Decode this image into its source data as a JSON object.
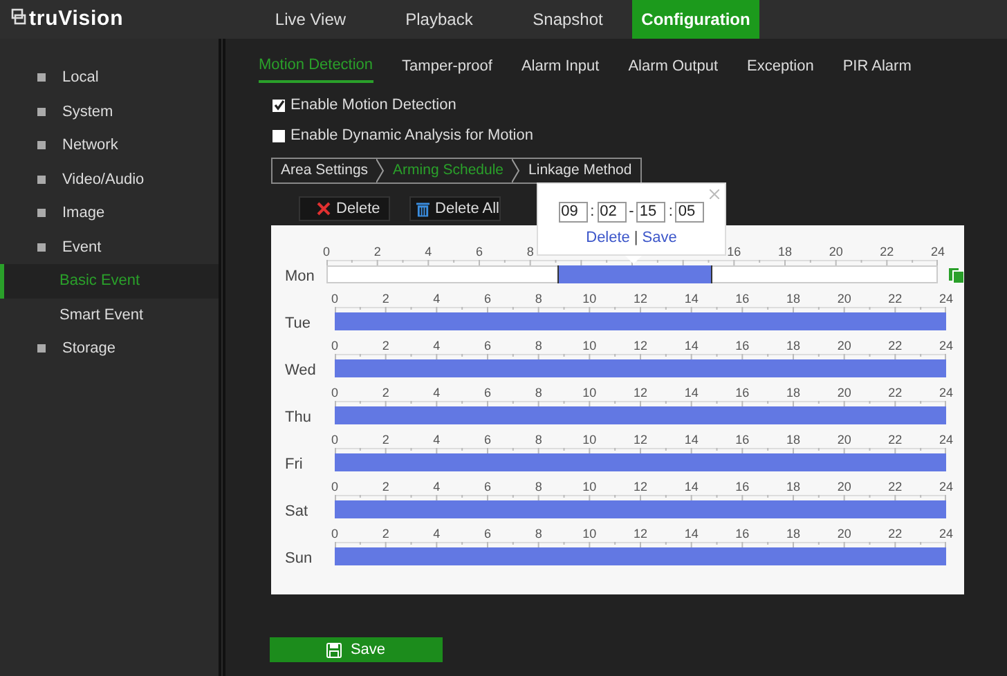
{
  "brand": {
    "name": "truVision"
  },
  "nav": [
    {
      "label": "Live View",
      "selected": false
    },
    {
      "label": "Playback",
      "selected": false
    },
    {
      "label": "Snapshot",
      "selected": false
    },
    {
      "label": "Configuration",
      "selected": true
    }
  ],
  "sidebar": {
    "items": [
      {
        "label": "Local",
        "kind": "group",
        "selected": false
      },
      {
        "label": "System",
        "kind": "group",
        "selected": false
      },
      {
        "label": "Network",
        "kind": "group",
        "selected": false
      },
      {
        "label": "Video/Audio",
        "kind": "group",
        "selected": false
      },
      {
        "label": "Image",
        "kind": "group",
        "selected": false
      },
      {
        "label": "Event",
        "kind": "group",
        "selected": false
      },
      {
        "label": "Basic Event",
        "kind": "sub",
        "selected": true
      },
      {
        "label": "Smart Event",
        "kind": "sub",
        "selected": false
      },
      {
        "label": "Storage",
        "kind": "group",
        "selected": false
      }
    ]
  },
  "subtabs": [
    {
      "label": "Motion Detection",
      "selected": true
    },
    {
      "label": "Tamper-proof",
      "selected": false
    },
    {
      "label": "Alarm Input",
      "selected": false
    },
    {
      "label": "Alarm Output",
      "selected": false
    },
    {
      "label": "Exception",
      "selected": false
    },
    {
      "label": "PIR Alarm",
      "selected": false
    }
  ],
  "options": [
    {
      "label": "Enable Motion Detection",
      "checked": true
    },
    {
      "label": "Enable Dynamic Analysis for Motion",
      "checked": false
    }
  ],
  "steps": [
    {
      "label": "Area Settings",
      "selected": false
    },
    {
      "label": "Arming Schedule",
      "selected": true
    },
    {
      "label": "Linkage Method",
      "selected": false
    }
  ],
  "toolbar": [
    {
      "label": "Delete",
      "kind": "delete"
    },
    {
      "label": "Delete All",
      "kind": "delete_all"
    }
  ],
  "schedule": {
    "days": [
      {
        "label": "Mon",
        "kind": "range",
        "ticks": [
          "0",
          "2",
          "4",
          "6",
          "8"
        ],
        "ticks_after_popup": [
          "16",
          "18",
          "20",
          "22",
          "24"
        ]
      },
      {
        "label": "Tue",
        "kind": "full",
        "ticks": [
          "0",
          "2",
          "4",
          "6",
          "8",
          "10",
          "12",
          "14",
          "16",
          "18",
          "20",
          "22",
          "24"
        ]
      },
      {
        "label": "Wed",
        "kind": "full",
        "ticks": [
          "0",
          "2",
          "4",
          "6",
          "8",
          "10",
          "12",
          "14",
          "16",
          "18",
          "20",
          "22",
          "24"
        ]
      },
      {
        "label": "Thu",
        "kind": "full",
        "ticks": [
          "0",
          "2",
          "4",
          "6",
          "8",
          "10",
          "12",
          "14",
          "16",
          "18",
          "20",
          "22",
          "24"
        ]
      },
      {
        "label": "Fri",
        "kind": "full",
        "ticks": [
          "0",
          "2",
          "4",
          "6",
          "8",
          "10",
          "12",
          "14",
          "16",
          "18",
          "20",
          "22",
          "24"
        ]
      },
      {
        "label": "Sat",
        "kind": "full",
        "ticks": [
          "0",
          "2",
          "4",
          "6",
          "8",
          "10",
          "12",
          "14",
          "16",
          "18",
          "20",
          "22",
          "24"
        ]
      },
      {
        "label": "Sun",
        "kind": "full",
        "ticks": [
          "0",
          "2",
          "4",
          "6",
          "8",
          "10",
          "12",
          "14",
          "16",
          "18",
          "20",
          "22",
          "24"
        ]
      }
    ]
  },
  "popup": {
    "time": [
      {
        "kind": "field",
        "text": "09"
      },
      {
        "kind": "sep",
        "text": ":"
      },
      {
        "kind": "field",
        "text": "02"
      },
      {
        "kind": "sep",
        "text": "-"
      },
      {
        "kind": "field",
        "text": "15"
      },
      {
        "kind": "sep",
        "text": ":"
      },
      {
        "kind": "field",
        "text": "05"
      }
    ],
    "actions": [
      {
        "kind": "link",
        "text": "Delete"
      },
      {
        "kind": "sep",
        "text": "|"
      },
      {
        "kind": "link",
        "text": "Save"
      }
    ]
  },
  "save_button": {
    "label": "Save"
  }
}
